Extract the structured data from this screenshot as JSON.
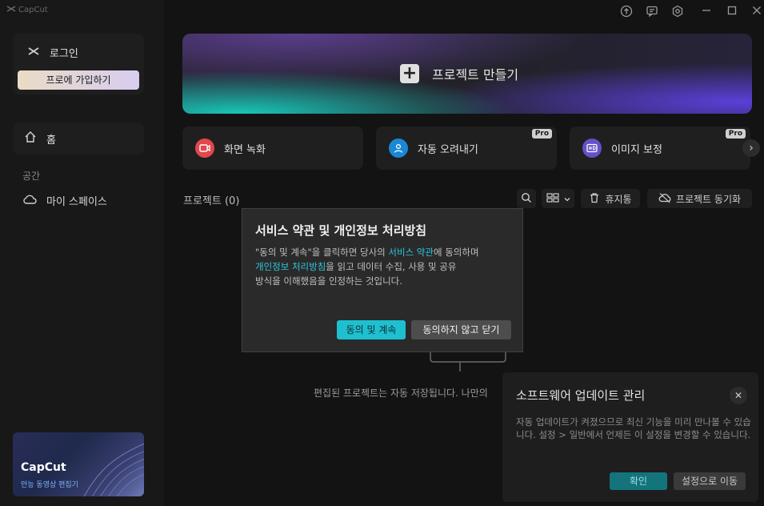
{
  "app": {
    "title": "CapCut"
  },
  "sidebar": {
    "login_label": "로그인",
    "pro_join_label": "프로에 가입하기",
    "home_label": "홈",
    "space_section": "공간",
    "myspace_label": "마이 스페이스",
    "promo": {
      "brand": "CapCut",
      "subtitle": "만능 동영상 편집기"
    }
  },
  "banner": {
    "create_label": "프로젝트 만들기"
  },
  "features": [
    {
      "label": "화면 녹화",
      "color": "#e2474b",
      "pro": ""
    },
    {
      "label": "자동 오려내기",
      "color": "#1a88d4",
      "pro": "Pro"
    },
    {
      "label": "이미지 보정",
      "color": "#6650c8",
      "pro": "Pro"
    }
  ],
  "projects": {
    "title": "프로젝트 (0)",
    "trash_label": "휴지통",
    "sync_label": "프로젝트 동기화",
    "empty_text": "편집된 프로젝트는 자동 저장됩니다. 나만의"
  },
  "modal": {
    "title": "서비스 약관 및 개인정보 처리방침",
    "body_1": "\"동의 및 계속\"을 클릭하면 당사의 ",
    "link_terms": "서비스 약관",
    "body_2": "에 동의하며",
    "link_privacy": "개인정보 처리방침",
    "body_3": "을 읽고 데이터 수집, 사용 및 공유",
    "body_4": "방식을 이해했음을 인정하는 것입니다.",
    "agree_label": "동의 및 계속",
    "decline_label": "동의하지 않고 닫기"
  },
  "update": {
    "title": "소프트웨어 업데이트 관리",
    "body": "자동 업데이트가 켜졌으므로 최신 기능을 미리 만나볼 수 있습니다. 설정 > 일반에서 언제든 이 설정을 변경할 수 있습니다.",
    "ok_label": "확인",
    "settings_label": "설정으로 이동"
  },
  "colors": {
    "accent": "#1ec0cf",
    "link": "#2ec7da"
  }
}
